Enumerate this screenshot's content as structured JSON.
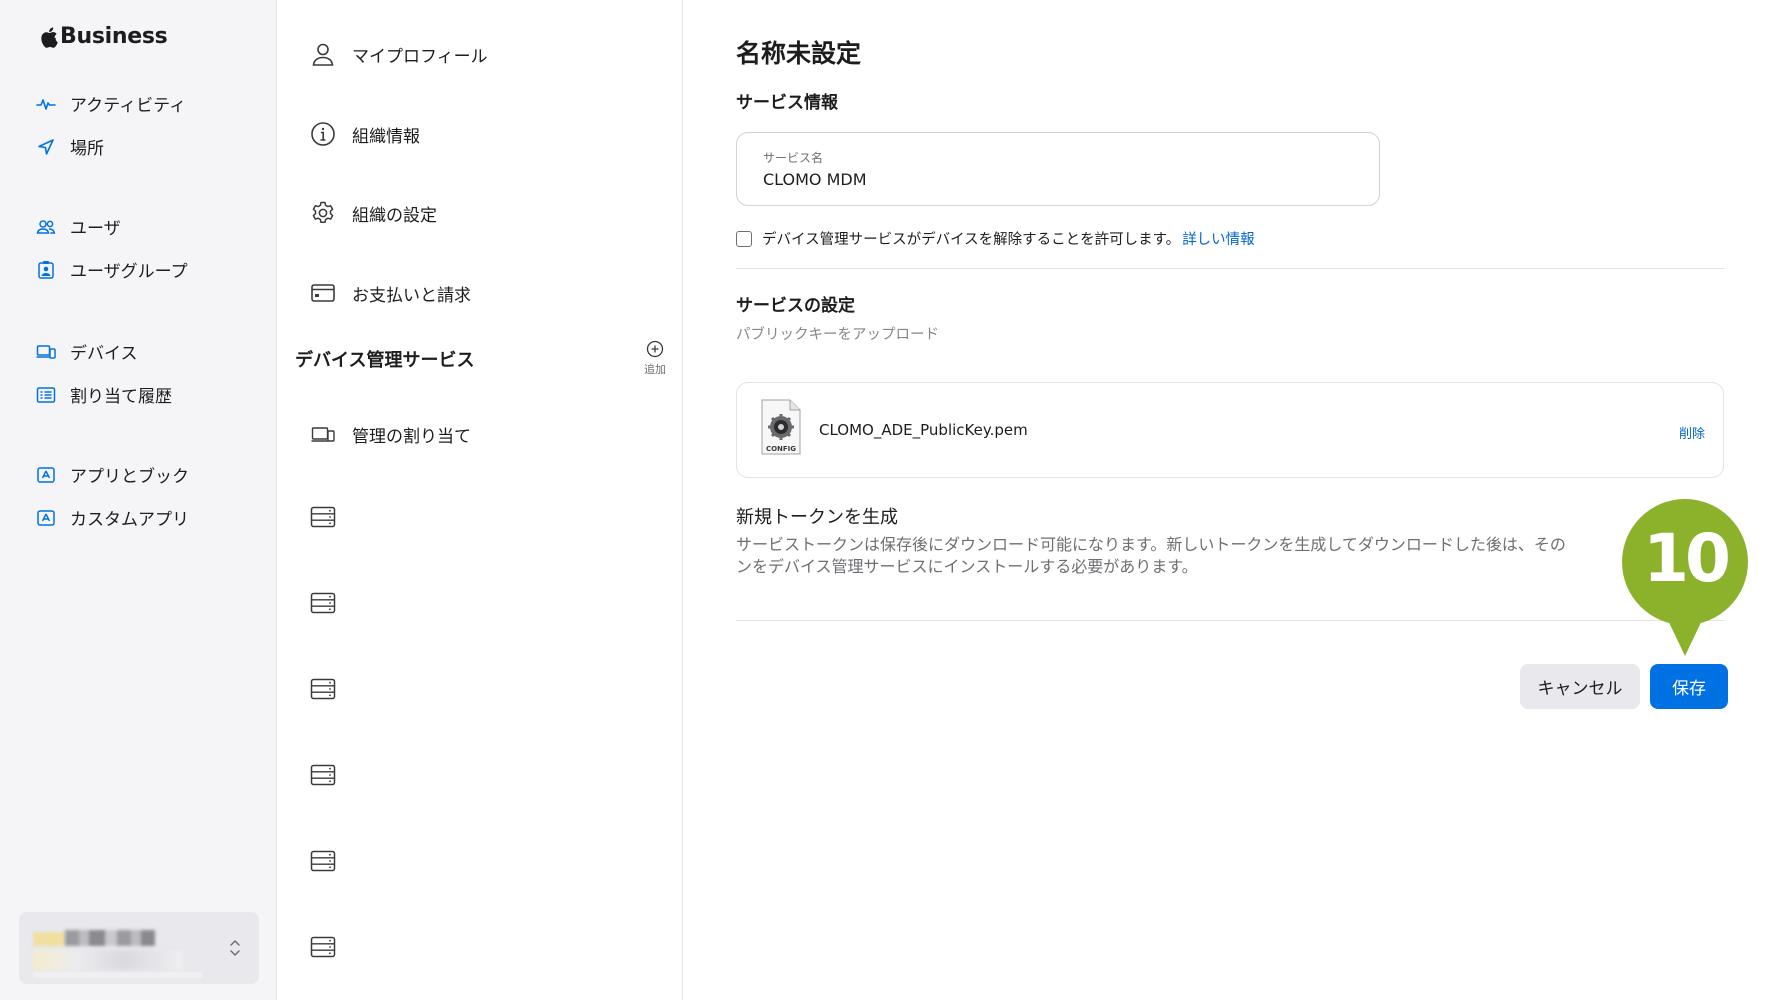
{
  "sidebar": {
    "brand": "Business",
    "groups": [
      [
        {
          "label": "アクティビティ",
          "icon": "activity-icon"
        },
        {
          "label": "場所",
          "icon": "location-icon"
        }
      ],
      [
        {
          "label": "ユーザ",
          "icon": "users-icon"
        },
        {
          "label": "ユーザグループ",
          "icon": "user-group-icon"
        }
      ],
      [
        {
          "label": "デバイス",
          "icon": "devices-icon"
        },
        {
          "label": "割り当て履歴",
          "icon": "assignment-history-icon"
        }
      ],
      [
        {
          "label": "アプリとブック",
          "icon": "apps-books-icon"
        },
        {
          "label": "カスタムアプリ",
          "icon": "custom-apps-icon"
        }
      ]
    ]
  },
  "midpanel": {
    "items": [
      {
        "label": "マイプロフィール",
        "icon": "person-icon"
      },
      {
        "label": "組織情報",
        "icon": "info-icon"
      },
      {
        "label": "組織の設定",
        "icon": "gear-icon"
      },
      {
        "label": "お支払いと請求",
        "icon": "credit-card-icon"
      }
    ],
    "section_title": "デバイス管理サービス",
    "add_label": "追加",
    "assignment_item": {
      "label": "管理の割り当て",
      "icon": "device-icon"
    },
    "server_count": 6
  },
  "main": {
    "title": "名称未設定",
    "service_info_heading": "サービス情報",
    "service_name_label": "サービス名",
    "service_name_value": "CLOMO MDM",
    "allow_release_text": "デバイス管理サービスがデバイスを解除することを許可します。",
    "learn_more_link": "詳しい情報",
    "service_settings_heading": "サービスの設定",
    "upload_public_key": "パブリックキーをアップロード",
    "file": {
      "name": "CLOMO_ADE_PublicKey.pem",
      "icon_caption": "CONFIG",
      "delete_label": "削除"
    },
    "token_heading": "新規トークンを生成",
    "token_description_line1": "サービストークンは保存後にダウンロード可能になります。新しいトークンを生成してダウンロードした後は、その",
    "token_description_line2": "ンをデバイス管理サービスにインストールする必要があります。",
    "cancel_label": "キャンセル",
    "save_label": "保存"
  },
  "step_marker": {
    "number": "10",
    "color": "#8cb12a"
  },
  "colors": {
    "accent": "#0071e3",
    "link": "#0066cc",
    "sidebar_bg": "#f5f5f7"
  }
}
